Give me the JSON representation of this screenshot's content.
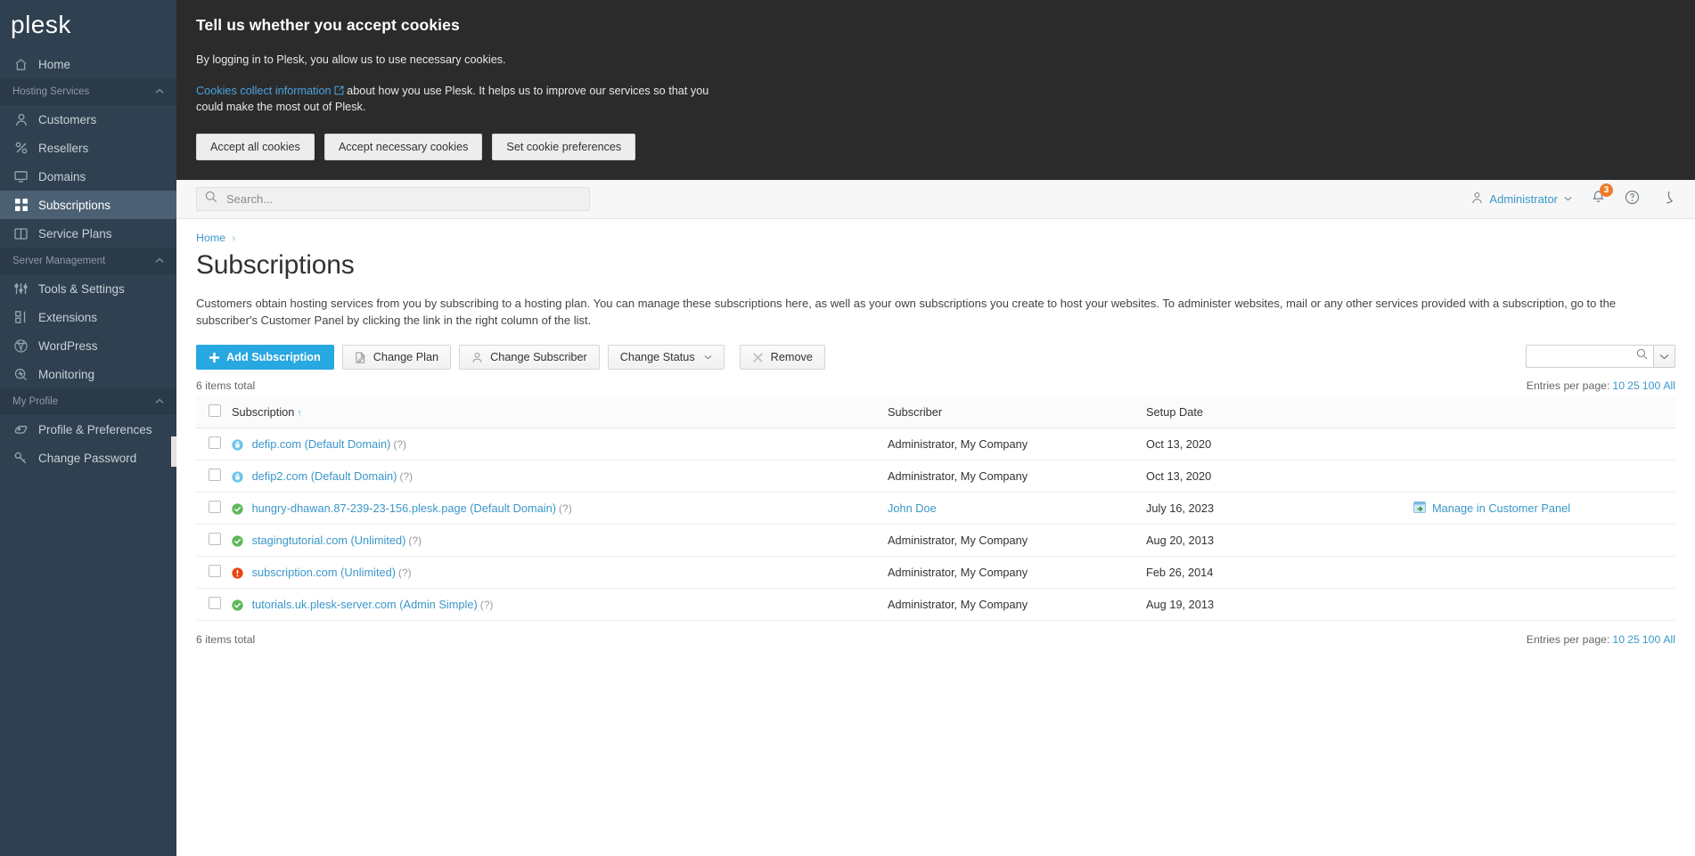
{
  "sidebar": {
    "logo": "plesk",
    "items": [
      {
        "label": "Home",
        "icon": "home-icon",
        "type": "item",
        "active": false
      },
      {
        "label": "Hosting Services",
        "icon": "chevron-up-icon",
        "type": "group"
      },
      {
        "label": "Customers",
        "icon": "user-icon",
        "type": "item",
        "active": false
      },
      {
        "label": "Resellers",
        "icon": "percent-icon",
        "type": "item",
        "active": false
      },
      {
        "label": "Domains",
        "icon": "monitor-icon",
        "type": "item",
        "active": false
      },
      {
        "label": "Subscriptions",
        "icon": "grid-icon",
        "type": "item",
        "active": true
      },
      {
        "label": "Service Plans",
        "icon": "book-icon",
        "type": "item",
        "active": false
      },
      {
        "label": "Server Management",
        "icon": "chevron-up-icon",
        "type": "group"
      },
      {
        "label": "Tools & Settings",
        "icon": "sliders-icon",
        "type": "item",
        "active": false
      },
      {
        "label": "Extensions",
        "icon": "extensions-icon",
        "type": "item",
        "active": false
      },
      {
        "label": "WordPress",
        "icon": "wordpress-icon",
        "type": "item",
        "active": false
      },
      {
        "label": "Monitoring",
        "icon": "monitoring-icon",
        "type": "item",
        "active": false
      },
      {
        "label": "My Profile",
        "icon": "chevron-up-icon",
        "type": "group"
      },
      {
        "label": "Profile & Preferences",
        "icon": "profile-icon",
        "type": "item",
        "active": false
      },
      {
        "label": "Change Password",
        "icon": "key-icon",
        "type": "item",
        "active": false
      }
    ]
  },
  "cookie_banner": {
    "title": "Tell us whether you accept cookies",
    "paragraph1": "By logging in to Plesk, you allow us to use necessary cookies.",
    "link_text": "Cookies collect information",
    "paragraph2": " about how you use Plesk. It helps us to improve our services so that you could make the most out of Plesk.",
    "buttons": {
      "accept_all": "Accept all cookies",
      "accept_necessary": "Accept necessary cookies",
      "set_preferences": "Set cookie preferences"
    }
  },
  "topbar": {
    "search_placeholder": "Search...",
    "user": "Administrator",
    "notification_count": "3"
  },
  "page": {
    "breadcrumb_home": "Home",
    "title": "Subscriptions",
    "description": "Customers obtain hosting services from you by subscribing to a hosting plan. You can manage these subscriptions here, as well as your own subscriptions you create to host your websites. To administer websites, mail or any other services provided with a subscription, go to the subscriber's Customer Panel by clicking the link in the right column of the list."
  },
  "toolbar": {
    "add_subscription": "Add Subscription",
    "change_plan": "Change Plan",
    "change_subscriber": "Change Subscriber",
    "change_status": "Change Status",
    "remove": "Remove",
    "filter_value": ""
  },
  "list_meta": {
    "items_total_top": "6 items total",
    "items_total_bottom": "6 items total",
    "entries_per_page_label": "Entries per page:",
    "entries_options": [
      "10",
      "25",
      "100",
      "All"
    ]
  },
  "table": {
    "headers": {
      "subscription": "Subscription",
      "sort_arrow": "↑",
      "subscriber": "Subscriber",
      "setup_date": "Setup Date",
      "action": ""
    },
    "rows": [
      {
        "status": "locked",
        "name": "defip.com (Default Domain)",
        "hint": "(?)",
        "subscriber": "Administrator, My Company",
        "subscriber_is_link": false,
        "setup_date": "Oct 13, 2020",
        "action": ""
      },
      {
        "status": "locked",
        "name": "defip2.com (Default Domain)",
        "hint": "(?)",
        "subscriber": "Administrator, My Company",
        "subscriber_is_link": false,
        "setup_date": "Oct 13, 2020",
        "action": ""
      },
      {
        "status": "active",
        "name": "hungry-dhawan.87-239-23-156.plesk.page (Default Domain)",
        "hint": "(?)",
        "subscriber": "John Doe",
        "subscriber_is_link": true,
        "setup_date": "July 16, 2023",
        "action": "Manage in Customer Panel"
      },
      {
        "status": "active",
        "name": "stagingtutorial.com (Unlimited)",
        "hint": "(?)",
        "subscriber": "Administrator, My Company",
        "subscriber_is_link": false,
        "setup_date": "Aug 20, 2013",
        "action": ""
      },
      {
        "status": "problem",
        "name": "subscription.com (Unlimited)",
        "hint": "(?)",
        "subscriber": "Administrator, My Company",
        "subscriber_is_link": false,
        "setup_date": "Feb 26, 2014",
        "action": ""
      },
      {
        "status": "active",
        "name": "tutorials.uk.plesk-server.com (Admin Simple)",
        "hint": "(?)",
        "subscriber": "Administrator, My Company",
        "subscriber_is_link": false,
        "setup_date": "Aug 19, 2013",
        "action": ""
      }
    ]
  },
  "colors": {
    "sidebar_bg": "#2f4050",
    "sidebar_active": "#4b6073",
    "accent_blue": "#28a8e0",
    "link_blue": "#3a97c9",
    "status_active": "#5cb85c",
    "status_problem": "#e8450f",
    "status_locked": "#5bc0de",
    "badge_orange": "#f07c29",
    "cookie_bg": "#2b2b2b"
  }
}
